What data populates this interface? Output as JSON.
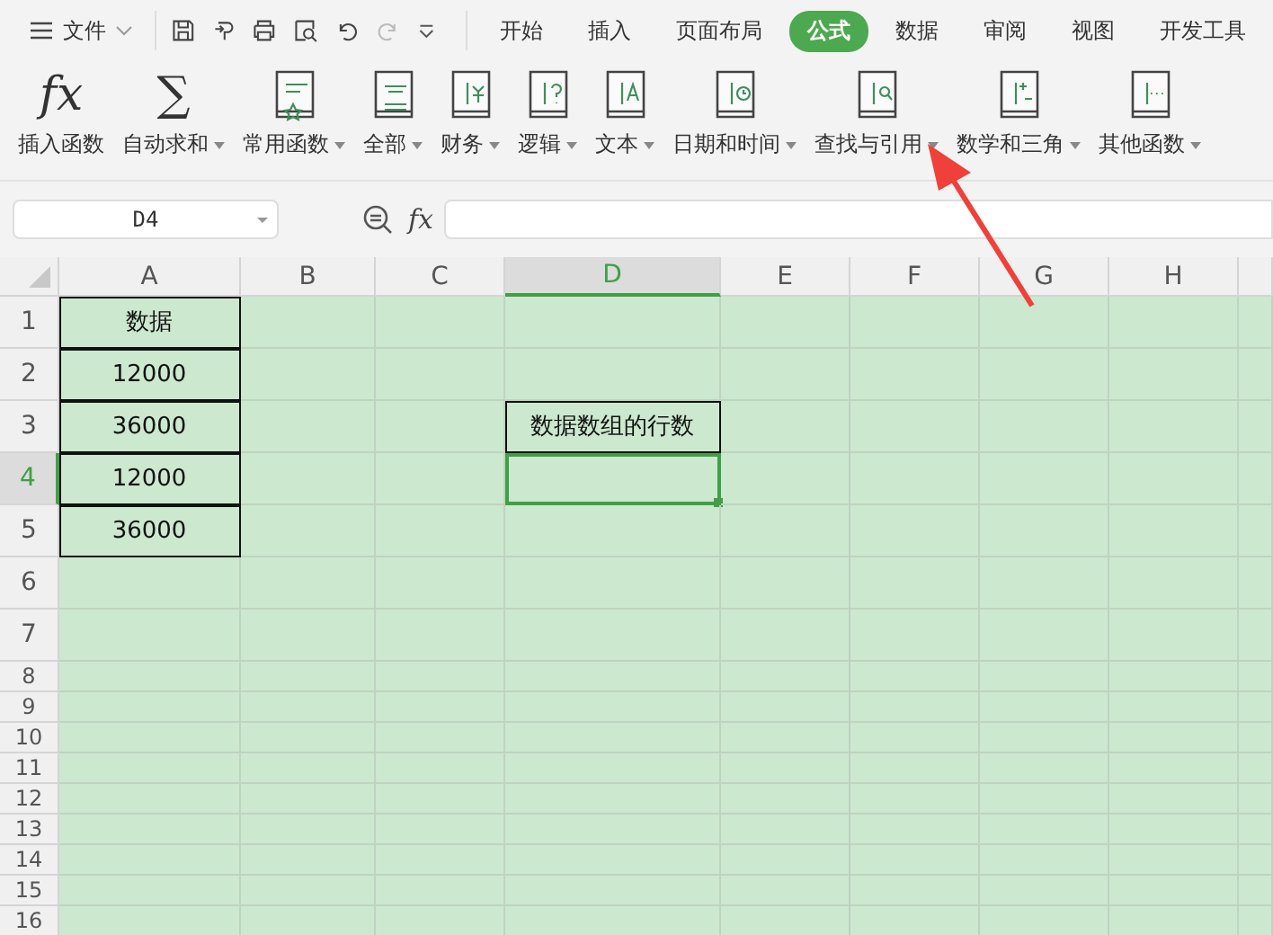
{
  "menu": {
    "label": "文件"
  },
  "tabs": [
    {
      "label": "开始",
      "selected": false
    },
    {
      "label": "插入",
      "selected": false
    },
    {
      "label": "页面布局",
      "selected": false
    },
    {
      "label": "公式",
      "selected": true
    },
    {
      "label": "数据",
      "selected": false
    },
    {
      "label": "审阅",
      "selected": false
    },
    {
      "label": "视图",
      "selected": false
    },
    {
      "label": "开发工具",
      "selected": false
    }
  ],
  "ribbon": [
    {
      "kind": "symbol",
      "symbol": "fx",
      "label": "插入函数",
      "dropdown": false
    },
    {
      "kind": "symbol",
      "symbol": "∑",
      "label": "自动求和",
      "dropdown": true
    },
    {
      "kind": "book",
      "label": "常用函数",
      "dropdown": true
    },
    {
      "kind": "book",
      "label": "全部",
      "dropdown": true
    },
    {
      "kind": "book",
      "label": "财务",
      "dropdown": true
    },
    {
      "kind": "book",
      "label": "逻辑",
      "dropdown": true
    },
    {
      "kind": "book",
      "label": "文本",
      "dropdown": true
    },
    {
      "kind": "book",
      "label": "日期和时间",
      "dropdown": true
    },
    {
      "kind": "book",
      "label": "查找与引用",
      "dropdown": true
    },
    {
      "kind": "book",
      "label": "数学和三角",
      "dropdown": true
    },
    {
      "kind": "book",
      "label": "其他函数",
      "dropdown": true
    }
  ],
  "formula_bar": {
    "name_box": "D4",
    "fx": "fx"
  },
  "columns": [
    {
      "label": "A",
      "selected": false
    },
    {
      "label": "B",
      "selected": false
    },
    {
      "label": "C",
      "selected": false
    },
    {
      "label": "D",
      "selected": true
    },
    {
      "label": "E",
      "selected": false
    },
    {
      "label": "F",
      "selected": false
    },
    {
      "label": "G",
      "selected": false
    },
    {
      "label": "H",
      "selected": false
    }
  ],
  "rows": [
    {
      "label": "1",
      "selected": false,
      "cells": [
        {
          "text": "数据",
          "bordered": true,
          "selected": false
        },
        {
          "bordered": false,
          "selected": false
        },
        {
          "bordered": false,
          "selected": false
        },
        {
          "bordered": false,
          "selected": false
        },
        {
          "bordered": false,
          "selected": false
        },
        {
          "bordered": false,
          "selected": false
        },
        {
          "bordered": false,
          "selected": false
        },
        {
          "bordered": false,
          "selected": false
        }
      ]
    },
    {
      "label": "2",
      "selected": false,
      "cells": [
        {
          "text": "12000",
          "bordered": true,
          "selected": false
        },
        {
          "bordered": false,
          "selected": false
        },
        {
          "bordered": false,
          "selected": false
        },
        {
          "bordered": false,
          "selected": false
        },
        {
          "bordered": false,
          "selected": false
        },
        {
          "bordered": false,
          "selected": false
        },
        {
          "bordered": false,
          "selected": false
        },
        {
          "bordered": false,
          "selected": false
        }
      ]
    },
    {
      "label": "3",
      "selected": false,
      "cells": [
        {
          "text": "36000",
          "bordered": true,
          "selected": false
        },
        {
          "bordered": false,
          "selected": false
        },
        {
          "bordered": false,
          "selected": false
        },
        {
          "text": "数据数组的行数",
          "bordered": true,
          "selected": false
        },
        {
          "bordered": false,
          "selected": false
        },
        {
          "bordered": false,
          "selected": false
        },
        {
          "bordered": false,
          "selected": false
        },
        {
          "bordered": false,
          "selected": false
        }
      ]
    },
    {
      "label": "4",
      "selected": true,
      "cells": [
        {
          "text": "12000",
          "bordered": true,
          "selected": false
        },
        {
          "bordered": false,
          "selected": false
        },
        {
          "bordered": false,
          "selected": false
        },
        {
          "bordered": false,
          "selected": true
        },
        {
          "bordered": false,
          "selected": false
        },
        {
          "bordered": false,
          "selected": false
        },
        {
          "bordered": false,
          "selected": false
        },
        {
          "bordered": false,
          "selected": false
        }
      ]
    },
    {
      "label": "5",
      "selected": false,
      "cells": [
        {
          "text": "36000",
          "bordered": true,
          "selected": false
        },
        {
          "bordered": false,
          "selected": false
        },
        {
          "bordered": false,
          "selected": false
        },
        {
          "bordered": false,
          "selected": false
        },
        {
          "bordered": false,
          "selected": false
        },
        {
          "bordered": false,
          "selected": false
        },
        {
          "bordered": false,
          "selected": false
        },
        {
          "bordered": false,
          "selected": false
        }
      ]
    },
    {
      "label": "6",
      "selected": false
    },
    {
      "label": "7",
      "selected": false
    },
    {
      "label": "8",
      "selected": false
    },
    {
      "label": "9",
      "selected": false
    },
    {
      "label": "10",
      "selected": false
    },
    {
      "label": "11",
      "selected": false
    },
    {
      "label": "12",
      "selected": false
    },
    {
      "label": "13",
      "selected": false
    },
    {
      "label": "14",
      "selected": false
    },
    {
      "label": "15",
      "selected": false
    },
    {
      "label": "16",
      "selected": false
    }
  ]
}
